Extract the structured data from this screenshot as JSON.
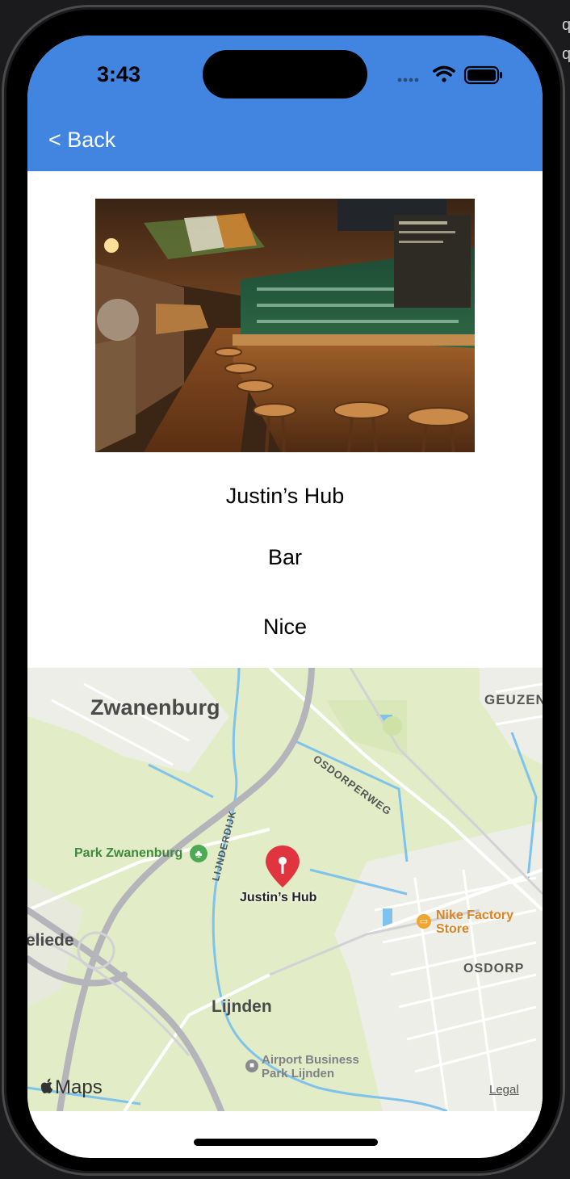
{
  "status_bar": {
    "time": "3:43"
  },
  "nav": {
    "back_label": "< Back"
  },
  "place": {
    "name": "Justin’s Hub",
    "category": "Bar",
    "rating": "Nice"
  },
  "map": {
    "labels": {
      "zwanenburg": "Zwanenburg",
      "geuzen": "GEUZEN",
      "osdorperweg": "OSDORPERWEG",
      "park_zwanenburg": "Park Zwanenburg",
      "lijnderdijk": "LIJNDERDIJK",
      "pin_label": "Justin’s Hub",
      "nike_line1": "Nike Factory",
      "nike_line2": "Store",
      "osdorp": "OSDORP",
      "eliede": "eliede",
      "lijnden": "Lijnden",
      "airport_line1": "Airport Business",
      "airport_line2": "Park Lijnden",
      "maps_brand": "Maps",
      "legal": "Legal"
    }
  },
  "colors": {
    "header": "#4285e0",
    "map_background": "#e2ecc6",
    "water": "#7ec3ec",
    "pin": "#e0353f"
  },
  "icons": [
    "wifi-icon",
    "battery-icon",
    "signal-icon",
    "map-pin-icon",
    "park-icon",
    "shopping-icon",
    "business-icon",
    "apple-logo-icon"
  ]
}
